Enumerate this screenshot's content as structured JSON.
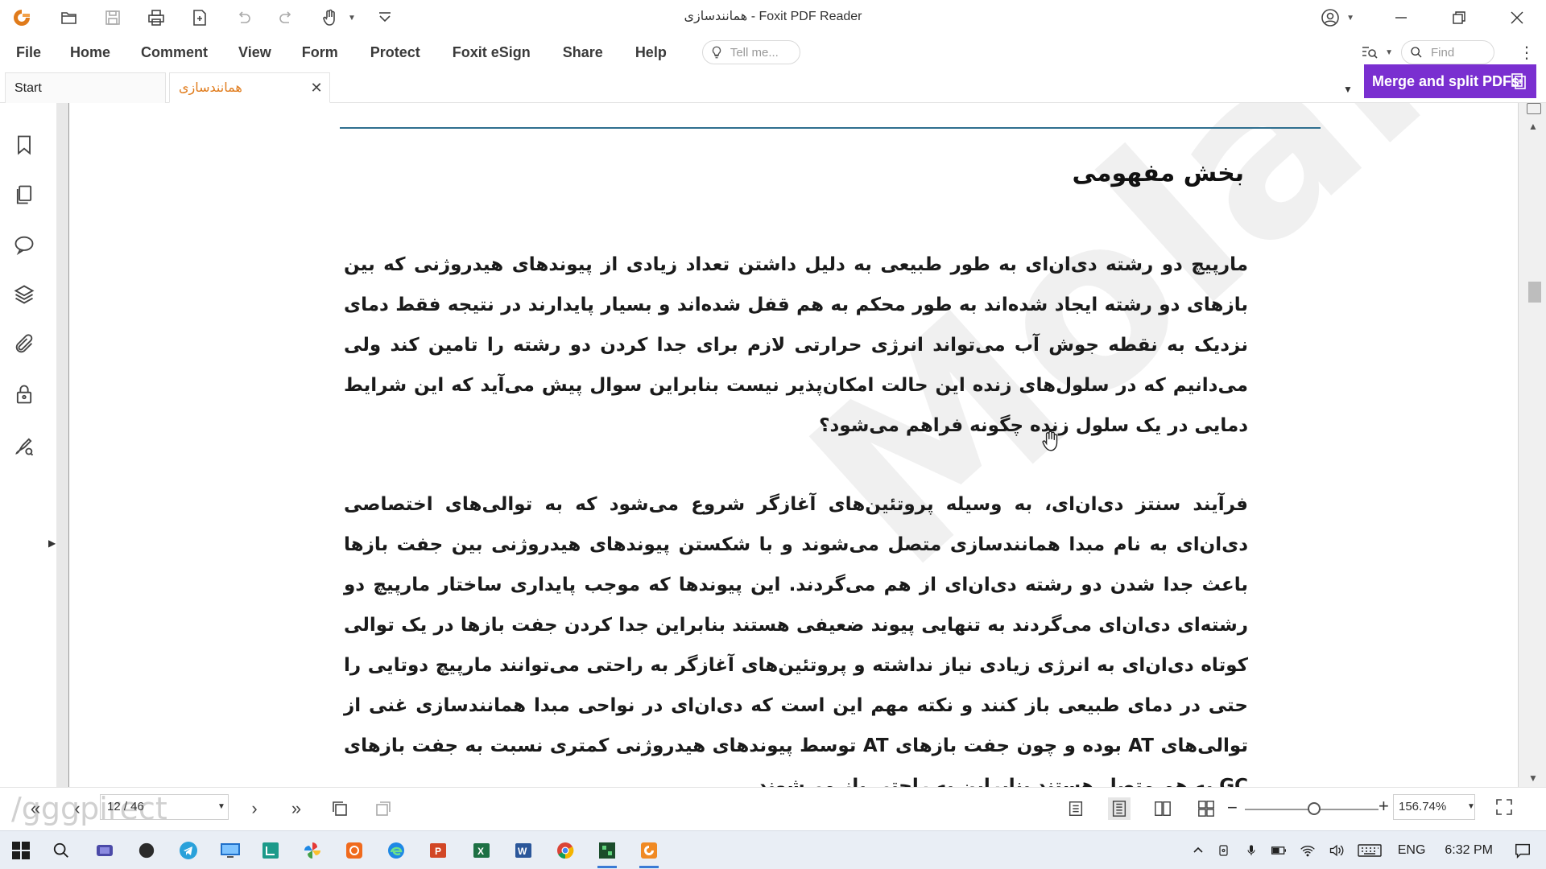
{
  "window": {
    "title": "همانندسازی - Foxit PDF Reader",
    "brand_color": "#e07b1b"
  },
  "menu": {
    "items": [
      "File",
      "Home",
      "Comment",
      "View",
      "Form",
      "Protect",
      "Foxit eSign",
      "Share",
      "Help"
    ],
    "tell_me_placeholder": "Tell me...",
    "find_placeholder": "Find"
  },
  "tabs": {
    "start_label": "Start",
    "doc_label": "همانندسازی"
  },
  "promo": {
    "merge_label": "Merge and split PDFs",
    "color": "#7a2fd0"
  },
  "document": {
    "heading": "بخش مفهومی",
    "paragraph1": "مارپیچ دو رشته دی‌ان‌ای به طور طبیعی به دلیل داشتن تعداد زیادی از پیوندهای هیدروژنی که بین بازهای دو رشته ایجاد شده‌اند به طور محکم به هم قفل شده‌اند و بسیار پایدارند در نتیجه فقط دمای نزدیک به نقطه جوش آب می‌تواند انرژی حرارتی لازم برای جدا کردن دو رشته را تامین کند ولی می‌دانیم که در سلول‌های زنده این حالت امکان‌پذیر نیست بنابراین سوال پیش می‌آید که این شرایط دمایی در یک سلول زنده چگونه فراهم می‌شود؟",
    "paragraph2": "فرآیند سنتز دی‌ان‌ای، به وسیله پروتئین‌های آغازگر شروع می‌شود که به توالی‌های اختصاصی دی‌ان‌ای به نام مبدا همانندسازی متصل می‌شوند و با شکستن پیوندهای هیدروژنی بین جفت بازها باعث جدا شدن دو رشته دی‌ان‌ای از هم می‌گردند. این پیوندها که موجب پایداری ساختار مارپیچ دو رشته‌ای دی‌ان‌ای می‌گردند به تنهایی پیوند ضعیفی هستند بنابراین جدا کردن جفت بازها در یک توالی کوتاه دی‌ان‌ای به انرژی زیادی نیاز نداشته و پروتئین‌های آغازگر به راحتی می‌توانند مارپیچ دوتایی را حتی در دمای طبیعی باز کنند و نکته مهم این است که دی‌ان‌ای در نواحی مبدا همانندسازی غنی از توالی‌های AT بوده و چون جفت بازهای AT توسط پیوندهای هیدروژنی کمتری نسبت به جفت بازهای GC به هم متصل هستند بنابراین به راحتی باز می‌شوند.",
    "watermark": "Molahi",
    "rule_color": "#2f6f8f"
  },
  "statusbar": {
    "page_value": "12 / 46",
    "zoom_value": "156.74%",
    "zoom_fraction": 0.52,
    "watermark_logo": "/gggpirect"
  },
  "taskbar": {
    "language": "ENG",
    "time": "6:32 PM"
  }
}
